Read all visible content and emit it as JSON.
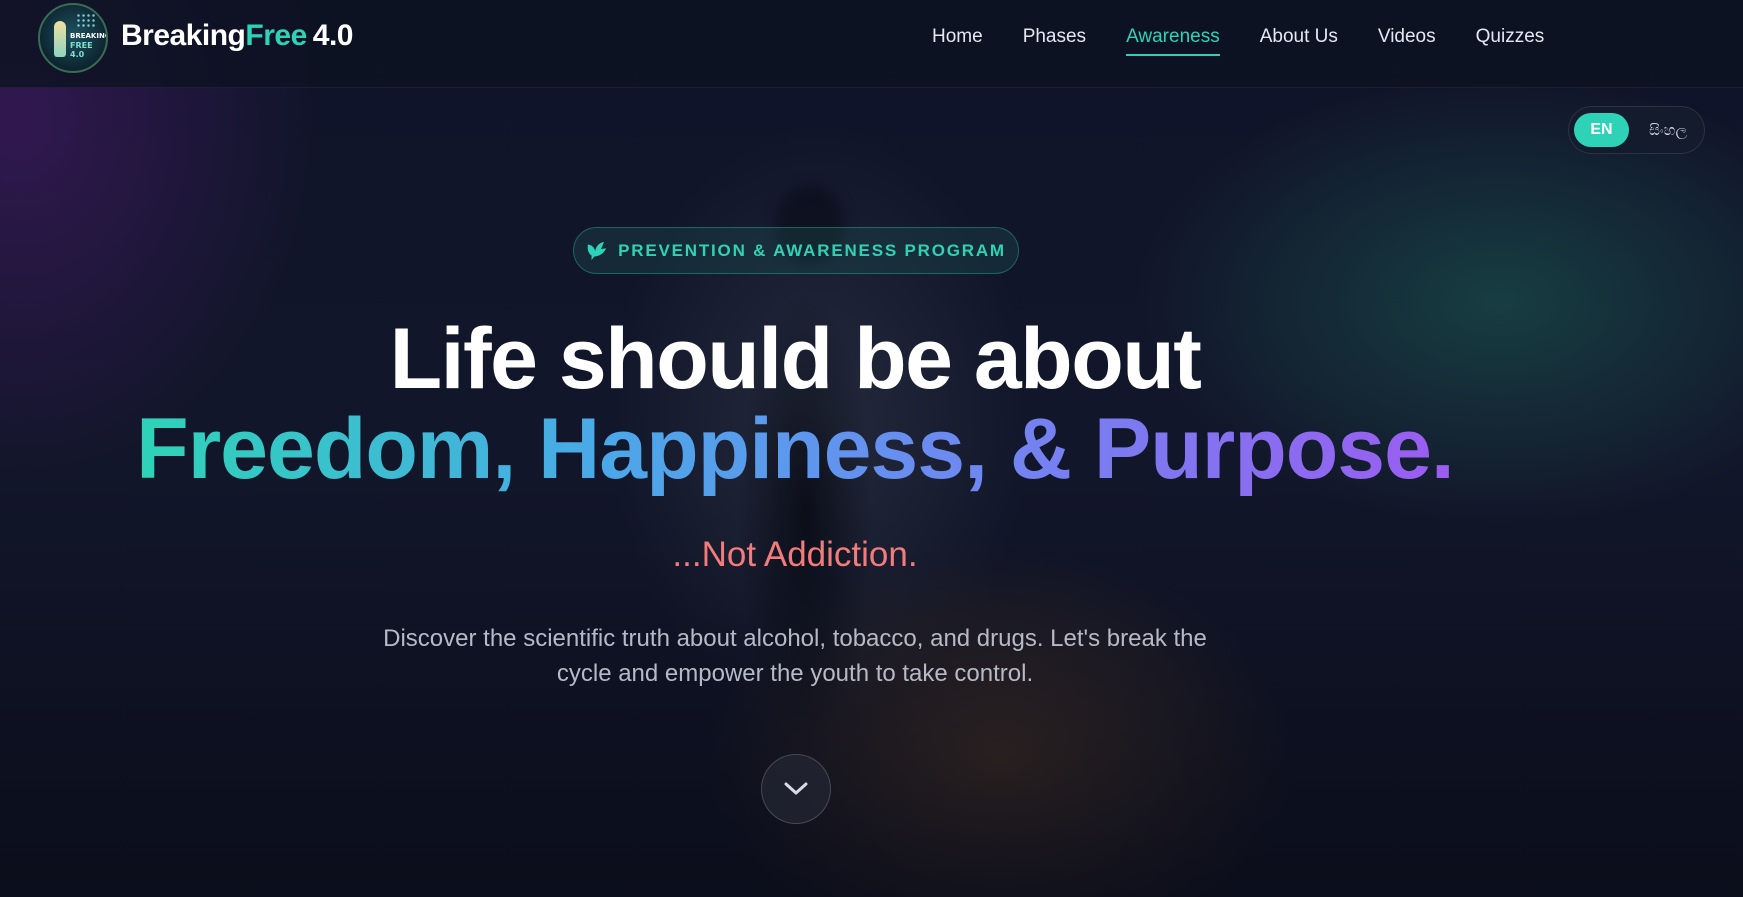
{
  "brand": {
    "logo_alt": "Breaking Free 4.0 logo",
    "logo_text_line1": "BREAKING",
    "logo_text_line2": "FREE 4.0",
    "name_part1": "Breaking",
    "name_part2": "Free",
    "name_part3": "4.0",
    "accent_color": "#2ed3b7"
  },
  "nav": {
    "items": [
      {
        "label": "Home",
        "active": false
      },
      {
        "label": "Phases",
        "active": false
      },
      {
        "label": "Awareness",
        "active": true
      },
      {
        "label": "About Us",
        "active": false
      },
      {
        "label": "Videos",
        "active": false
      },
      {
        "label": "Quizzes",
        "active": false
      }
    ]
  },
  "language": {
    "en_label": "EN",
    "si_label": "සිංහල",
    "selected": "EN"
  },
  "hero": {
    "badge_icon": "dove-icon",
    "badge_label": "PREVENTION & AWARENESS PROGRAM",
    "headline_line1": "Life should be about",
    "headline_line2": "Freedom, Happiness, & Purpose.",
    "subheadline": "...Not Addiction.",
    "subheadline_color": "#f27b7b",
    "description": "Discover the scientific truth about alcohol, tobacco, and drugs. Let's break the cycle and empower the youth to take control.",
    "scroll_icon": "chevron-down-icon"
  }
}
